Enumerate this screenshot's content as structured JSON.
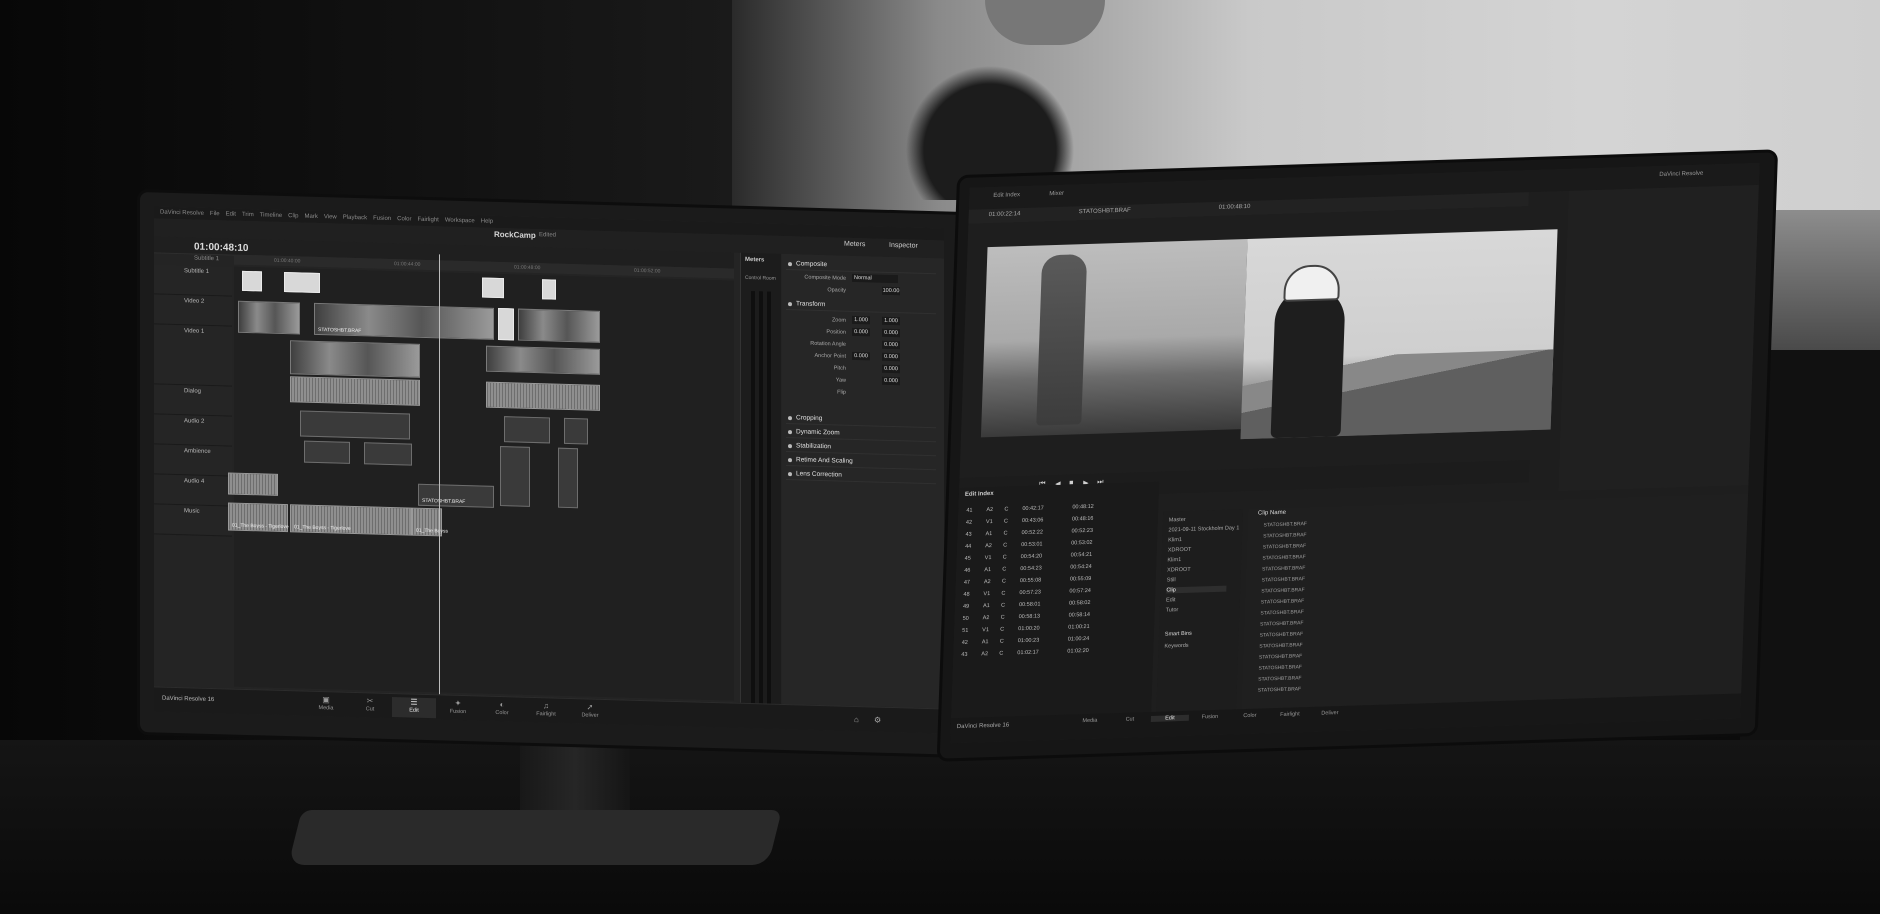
{
  "left_monitor": {
    "menu": [
      "DaVinci Resolve",
      "File",
      "Edit",
      "Trim",
      "Timeline",
      "Clip",
      "Mark",
      "View",
      "Playback",
      "Fusion",
      "Color",
      "Fairlight",
      "Workspace",
      "Help"
    ],
    "project_title": "RockCamp",
    "project_status": "Edited",
    "meters_btn": "Meters",
    "inspector_btn": "Inspector",
    "timecode": "01:00:48:10",
    "timeline_sub": "Subtitle 1",
    "ruler_ticks": [
      "01:00:40:00",
      "01:00:44:00",
      "01:00:48:00",
      "01:00:52:00"
    ],
    "tracks": [
      {
        "name": "Subtitle 1"
      },
      {
        "name": "Video 2"
      },
      {
        "name": "Video 1"
      },
      {
        "name": "Dialog"
      },
      {
        "name": "Audio 2"
      },
      {
        "name": "Ambience"
      },
      {
        "name": "Audio 4"
      },
      {
        "name": "Music"
      }
    ],
    "clip_labels": [
      "STATOSHBT.BRAF",
      "STATOSHBT.BRAF",
      "01_The Boyss - Tigerlove",
      "01_The Boyss - Tigerlove",
      "01_The Boyss"
    ],
    "meters_title": "Meters",
    "control_room": "Control Room",
    "inspector": {
      "sections": [
        "Composite",
        "Transform",
        "Cropping",
        "Dynamic Zoom",
        "Stabilization",
        "Retime And Scaling",
        "Lens Correction"
      ],
      "composite_mode_label": "Composite Mode",
      "composite_mode_value": "Normal",
      "opacity_label": "Opacity",
      "opacity_value": "100.00",
      "zoom_label": "Zoom",
      "zoom_x": "1.000",
      "zoom_y": "1.000",
      "position_label": "Position",
      "position_x": "0.000",
      "position_y": "0.000",
      "rotation_label": "Rotation Angle",
      "rotation_value": "0.000",
      "anchor_label": "Anchor Point",
      "anchor_x": "0.000",
      "anchor_y": "0.000",
      "pitch_label": "Pitch",
      "pitch_value": "0.000",
      "yaw_label": "Yaw",
      "yaw_value": "0.000",
      "flip_label": "Flip"
    },
    "brand": "DaVinci Resolve 16",
    "pages": [
      "Media",
      "Cut",
      "Edit",
      "Fusion",
      "Color",
      "Fairlight",
      "Deliver"
    ],
    "active_page": "Edit"
  },
  "right_monitor": {
    "top_left": "Edit Index",
    "top_mid": "Mixer",
    "top_right": "DaVinci Resolve",
    "tc_a": "01:00:22:14",
    "tc_b": "01:00:48:10",
    "clip_name": "STATOSHBT.BRAF",
    "edit_index_title": "Edit Index",
    "edit_index_rows": [
      {
        "n": "41",
        "t": "A2",
        "c": "C",
        "src": "00:42:17",
        "dur": "00:48:12"
      },
      {
        "n": "42",
        "t": "V1",
        "c": "C",
        "src": "00:43:06",
        "dur": "00:48:16"
      },
      {
        "n": "43",
        "t": "A1",
        "c": "C",
        "src": "00:52:22",
        "dur": "00:52:23"
      },
      {
        "n": "44",
        "t": "A2",
        "c": "C",
        "src": "00:53:01",
        "dur": "00:53:02"
      },
      {
        "n": "45",
        "t": "V1",
        "c": "C",
        "src": "00:54:20",
        "dur": "00:54:21"
      },
      {
        "n": "46",
        "t": "A1",
        "c": "C",
        "src": "00:54:23",
        "dur": "00:54:24"
      },
      {
        "n": "47",
        "t": "A2",
        "c": "C",
        "src": "00:55:08",
        "dur": "00:55:09"
      },
      {
        "n": "48",
        "t": "V1",
        "c": "C",
        "src": "00:57:23",
        "dur": "00:57:24"
      },
      {
        "n": "49",
        "t": "A1",
        "c": "C",
        "src": "00:58:01",
        "dur": "00:58:02"
      },
      {
        "n": "50",
        "t": "A2",
        "c": "C",
        "src": "00:58:13",
        "dur": "00:58:14"
      },
      {
        "n": "51",
        "t": "V1",
        "c": "C",
        "src": "01:00:20",
        "dur": "01:00:21"
      },
      {
        "n": "42",
        "t": "A1",
        "c": "C",
        "src": "01:00:23",
        "dur": "01:00:24"
      },
      {
        "n": "43",
        "t": "A2",
        "c": "C",
        "src": "01:02:17",
        "dur": "01:02:20"
      }
    ],
    "bins": [
      "Master",
      "2021-09-11 Stockholm Day 1",
      "Klim1",
      "XDROOT",
      "Klim1",
      "XDROOT",
      "Still",
      "Clip",
      "Edit",
      "Tutor"
    ],
    "smart_bins": "Smart Bins",
    "keywords": "Keywords",
    "clip_list_header": "Clip Name",
    "clip_rows": [
      "STATOSHBT.BRAF",
      "STATOSHBT.BRAF",
      "STATOSHBT.BRAF",
      "STATOSHBT.BRAF",
      "STATOSHBT.BRAF",
      "STATOSHBT.BRAF",
      "STATOSHBT.BRAF",
      "STATOSHBT.BRAF",
      "STATOSHBT.BRAF",
      "STATOSHBT.BRAF",
      "STATOSHBT.BRAF",
      "STATOSHBT.BRAF",
      "STATOSHBT.BRAF",
      "STATOSHBT.BRAF",
      "STATOSHBT.BRAF",
      "STATOSHBT.BRAF"
    ],
    "brand": "DaVinci Resolve 16",
    "pages": [
      "Media",
      "Cut",
      "Edit",
      "Fusion",
      "Color",
      "Fairlight",
      "Deliver"
    ],
    "active_page": "Edit"
  }
}
